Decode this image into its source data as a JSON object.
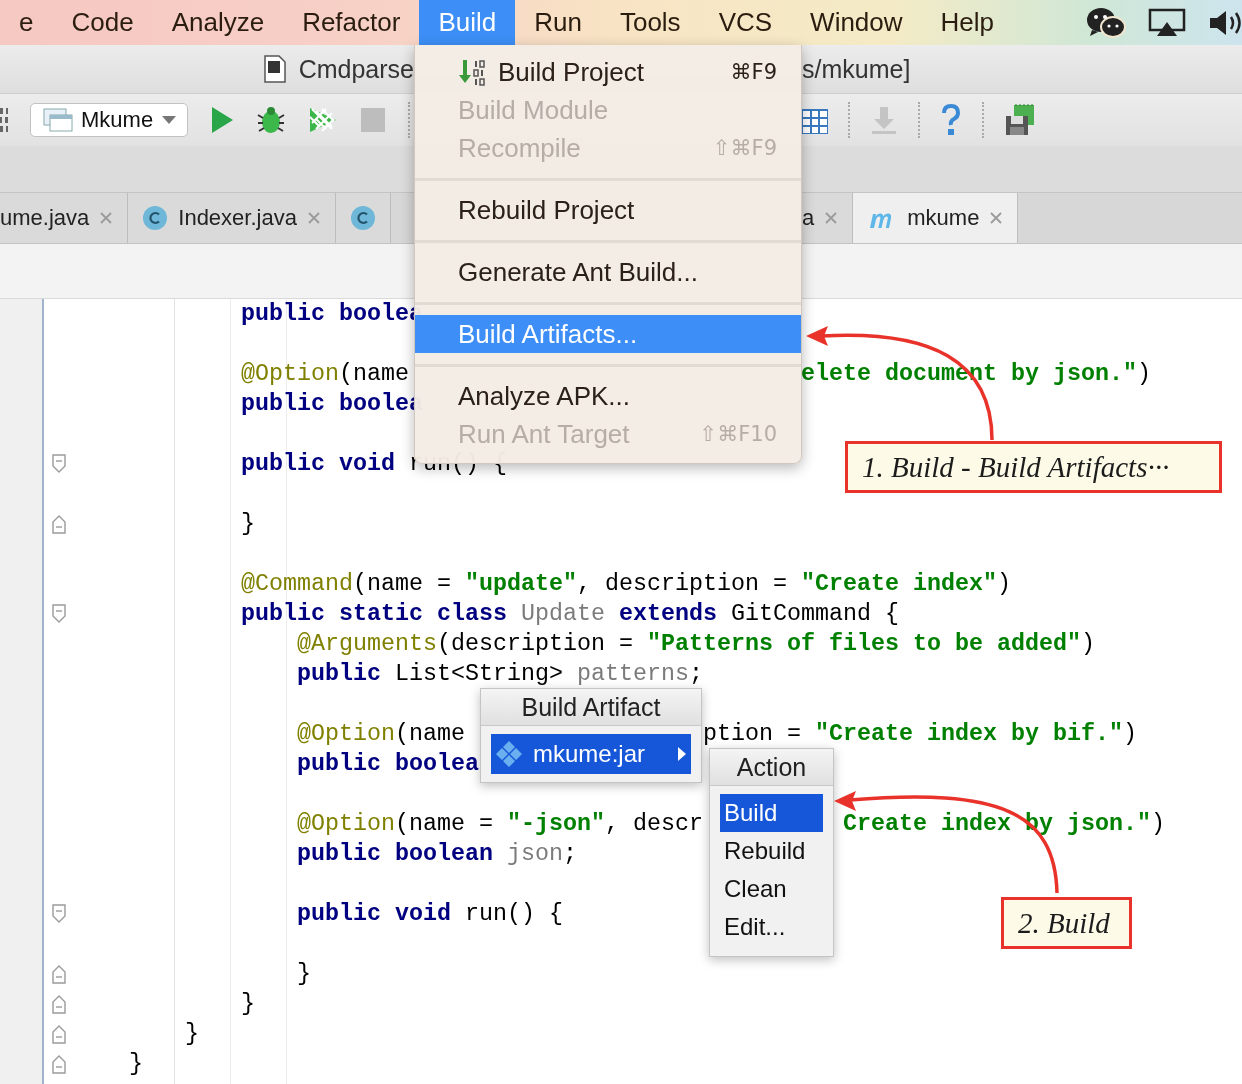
{
  "menubar": {
    "items": [
      {
        "label": "e",
        "selected": false
      },
      {
        "label": "Code",
        "selected": false
      },
      {
        "label": "Analyze",
        "selected": false
      },
      {
        "label": "Refactor",
        "selected": false
      },
      {
        "label": "Build",
        "selected": true
      },
      {
        "label": "Run",
        "selected": false
      },
      {
        "label": "Tools",
        "selected": false
      },
      {
        "label": "VCS",
        "selected": false
      },
      {
        "label": "Window",
        "selected": false
      },
      {
        "label": "Help",
        "selected": false
      }
    ]
  },
  "title_bar": {
    "title_left": "Cmdparse",
    "title_right": "s/mkume]"
  },
  "toolbar": {
    "run_config": "Mkume"
  },
  "tabs": {
    "left": [
      {
        "label": "ume.java",
        "kind": "plain",
        "selected": false
      },
      {
        "label": "Indexer.java",
        "kind": "class",
        "selected": false
      },
      {
        "kind": "class",
        "selected": false
      }
    ],
    "right": [
      {
        "label": "a",
        "kind": "plain",
        "selected": false
      },
      {
        "label": "mkume",
        "kind": "module",
        "selected": true
      }
    ]
  },
  "editor": {
    "blocks": [
      {
        "lines": [
          {
            "fold_start": false,
            "fold_end": false,
            "tokens": [
              {
                "kind": "kw",
                "text": "            public boolea"
              }
            ]
          }
        ]
      },
      {
        "lines": [
          {
            "fold_start": false,
            "fold_end": false,
            "tokens": [
              {
                "kind": "ann",
                "text": "            @Option"
              },
              {
                "kind": "plain",
                "text": "(name "
              }
            ],
            "right": {
              "kind": "menu",
              "tokens": [
                {
                  "kind": "str",
                  "text": "elete document by json.\""
                },
                {
                  "kind": "plain",
                  "text": ")"
                }
              ]
            }
          },
          {
            "fold_start": false,
            "fold_end": false,
            "tokens": [
              {
                "kind": "kw",
                "text": "            public boolea"
              }
            ]
          }
        ]
      },
      {
        "lines": [
          {
            "fold_start": true,
            "fold_end": false,
            "tokens": [
              {
                "kind": "kw",
                "text": "            public void "
              },
              {
                "kind": "plain",
                "text": "run() {"
              }
            ]
          }
        ]
      },
      {
        "lines": [
          {
            "fold_start": false,
            "fold_end": true,
            "tokens": [
              {
                "kind": "plain",
                "text": "            }"
              }
            ]
          }
        ]
      },
      {
        "lines": [
          {
            "fold_start": false,
            "fold_end": false,
            "tokens": [
              {
                "kind": "ann",
                "text": "            @Command"
              },
              {
                "kind": "plain",
                "text": "(name = "
              },
              {
                "kind": "str",
                "text": "\"update\""
              },
              {
                "kind": "plain",
                "text": ", description = "
              },
              {
                "kind": "str",
                "text": "\"Create index\""
              },
              {
                "kind": "plain",
                "text": ")"
              }
            ]
          },
          {
            "fold_start": true,
            "fold_end": false,
            "tokens": [
              {
                "kind": "kw",
                "text": "            public static class "
              },
              {
                "kind": "dim",
                "text": "Update"
              },
              {
                "kind": "kw",
                "text": " extends "
              },
              {
                "kind": "plain",
                "text": "GitCommand {"
              }
            ]
          },
          {
            "fold_start": false,
            "fold_end": false,
            "tokens": [
              {
                "kind": "ann",
                "text": "                @Arguments"
              },
              {
                "kind": "plain",
                "text": "(description = "
              },
              {
                "kind": "str",
                "text": "\"Patterns of files to be added\""
              },
              {
                "kind": "plain",
                "text": ")"
              }
            ]
          },
          {
            "fold_start": false,
            "fold_end": false,
            "tokens": [
              {
                "kind": "kw",
                "text": "                public "
              },
              {
                "kind": "plain",
                "text": "List<String> "
              },
              {
                "kind": "dim",
                "text": "patterns"
              },
              {
                "kind": "plain",
                "text": ";"
              }
            ]
          }
        ]
      },
      {
        "lines": [
          {
            "fold_start": false,
            "fold_end": false,
            "tokens": [
              {
                "kind": "ann",
                "text": "                @Option"
              },
              {
                "kind": "plain",
                "text": "(name "
              }
            ],
            "right": {
              "kind": "artifact",
              "tokens": [
                {
                  "kind": "plain",
                  "text": "ption = "
                },
                {
                  "kind": "str",
                  "text": "\"Create index by bif.\""
                },
                {
                  "kind": "plain",
                  "text": ")"
                }
              ]
            }
          },
          {
            "fold_start": false,
            "fold_end": false,
            "tokens": [
              {
                "kind": "kw",
                "text": "                public boolea"
              }
            ]
          }
        ]
      },
      {
        "lines": [
          {
            "fold_start": false,
            "fold_end": false,
            "tokens": [
              {
                "kind": "ann",
                "text": "                @Option"
              },
              {
                "kind": "plain",
                "text": "(name = "
              },
              {
                "kind": "str",
                "text": "\"-json\""
              },
              {
                "kind": "plain",
                "text": ", descr"
              }
            ],
            "right": {
              "kind": "action",
              "tokens": [
                {
                  "kind": "str",
                  "text": "Create index by json.\""
                },
                {
                  "kind": "plain",
                  "text": ")"
                }
              ]
            }
          },
          {
            "fold_start": false,
            "fold_end": false,
            "tokens": [
              {
                "kind": "kw",
                "text": "                public boolean "
              },
              {
                "kind": "dim",
                "text": "json"
              },
              {
                "kind": "plain",
                "text": ";"
              }
            ]
          }
        ]
      },
      {
        "lines": [
          {
            "fold_start": true,
            "fold_end": false,
            "tokens": [
              {
                "kind": "kw",
                "text": "                public void "
              },
              {
                "kind": "plain",
                "text": "run() {"
              }
            ]
          }
        ]
      },
      {
        "lines": [
          {
            "fold_start": false,
            "fold_end": true,
            "tokens": [
              {
                "kind": "plain",
                "text": "                }"
              }
            ]
          },
          {
            "fold_start": false,
            "fold_end": true,
            "tokens": [
              {
                "kind": "plain",
                "text": "            }"
              }
            ]
          },
          {
            "fold_start": false,
            "fold_end": true,
            "tokens": [
              {
                "kind": "plain",
                "text": "        }"
              }
            ]
          },
          {
            "fold_start": false,
            "fold_end": true,
            "tokens": [
              {
                "kind": "plain",
                "text": "    }"
              }
            ]
          }
        ]
      }
    ]
  },
  "build_menu": {
    "groups": [
      {
        "items": [
          {
            "label": "Build Project",
            "kind": "build",
            "shortcut": "⌘F9",
            "disabled": false,
            "selected": false
          },
          {
            "label": "Build Module",
            "kind": "plain",
            "disabled": true,
            "selected": false
          },
          {
            "label": "Recompile",
            "kind": "plain",
            "shortcut": "⇧⌘F9",
            "disabled": true,
            "selected": false
          }
        ]
      },
      {
        "items": [
          {
            "label": "Rebuild Project",
            "kind": "plain",
            "disabled": false,
            "selected": false
          }
        ]
      },
      {
        "items": [
          {
            "label": "Generate Ant Build...",
            "kind": "plain",
            "disabled": false,
            "selected": false
          }
        ]
      },
      {
        "items": [
          {
            "label": "Build Artifacts...",
            "kind": "plain",
            "disabled": false,
            "selected": true
          }
        ]
      },
      {
        "items": [
          {
            "label": "Analyze APK...",
            "kind": "plain",
            "disabled": false,
            "selected": false
          },
          {
            "label": "Run Ant Target",
            "kind": "plain",
            "shortcut": "⇧⌘F10",
            "disabled": true,
            "selected": false
          }
        ]
      }
    ]
  },
  "artifact_popup": {
    "title": "Build Artifact",
    "items": [
      {
        "label": "mkume:jar",
        "selected": true,
        "submenu": true
      }
    ]
  },
  "action_popup": {
    "title": "Action",
    "items": [
      {
        "label": "Build",
        "selected": true
      },
      {
        "label": "Rebuild",
        "selected": false
      },
      {
        "label": "Clean",
        "selected": false
      },
      {
        "label": "Edit...",
        "selected": false
      }
    ]
  },
  "callouts": [
    {
      "text": "1. Build - Build Artifacts···"
    },
    {
      "text": "2. Build"
    }
  ]
}
